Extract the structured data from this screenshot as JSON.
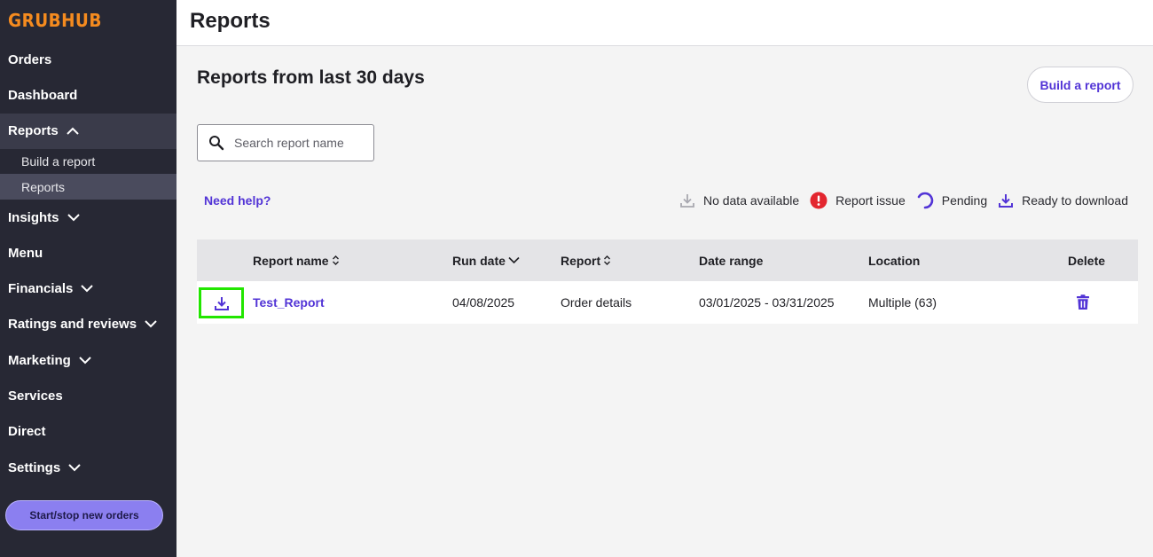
{
  "brand": {
    "logo": "GRUBHUB",
    "logo_color": "#f58b1f"
  },
  "sidebar": {
    "items": [
      {
        "label": "Orders"
      },
      {
        "label": "Dashboard"
      },
      {
        "label": "Reports",
        "expanded": true,
        "children": [
          {
            "label": "Build a report"
          },
          {
            "label": "Reports",
            "active": true
          }
        ]
      },
      {
        "label": "Insights"
      },
      {
        "label": "Menu"
      },
      {
        "label": "Financials"
      },
      {
        "label": "Ratings and reviews"
      },
      {
        "label": "Marketing"
      },
      {
        "label": "Services"
      },
      {
        "label": "Direct"
      },
      {
        "label": "Settings"
      }
    ],
    "start_stop_label": "Start/stop new orders"
  },
  "header": {
    "title": "Reports"
  },
  "main": {
    "title": "Reports from last 30 days",
    "build_button": "Build a report",
    "search": {
      "placeholder": "Search report name",
      "value": ""
    },
    "help_link": "Need help?",
    "legend": [
      {
        "icon": "download-disabled-icon",
        "label": "No data available"
      },
      {
        "icon": "report-issue-icon",
        "label": "Report issue"
      },
      {
        "icon": "pending-icon",
        "label": "Pending"
      },
      {
        "icon": "download-icon",
        "label": "Ready to download"
      }
    ],
    "table": {
      "columns": [
        "Report name",
        "Run date",
        "Report",
        "Date range",
        "Location",
        "Delete"
      ],
      "rows": [
        {
          "status_icon": "download-icon",
          "report_name": "Test_Report",
          "run_date": "04/08/2025",
          "report": "Order details",
          "date_range": "03/01/2025 - 03/31/2025",
          "location": "Multiple (63)"
        }
      ]
    }
  },
  "colors": {
    "accent": "#5234d6",
    "sidebar_bg": "#272834",
    "issue": "#e3262f",
    "highlight": "#22e600"
  }
}
